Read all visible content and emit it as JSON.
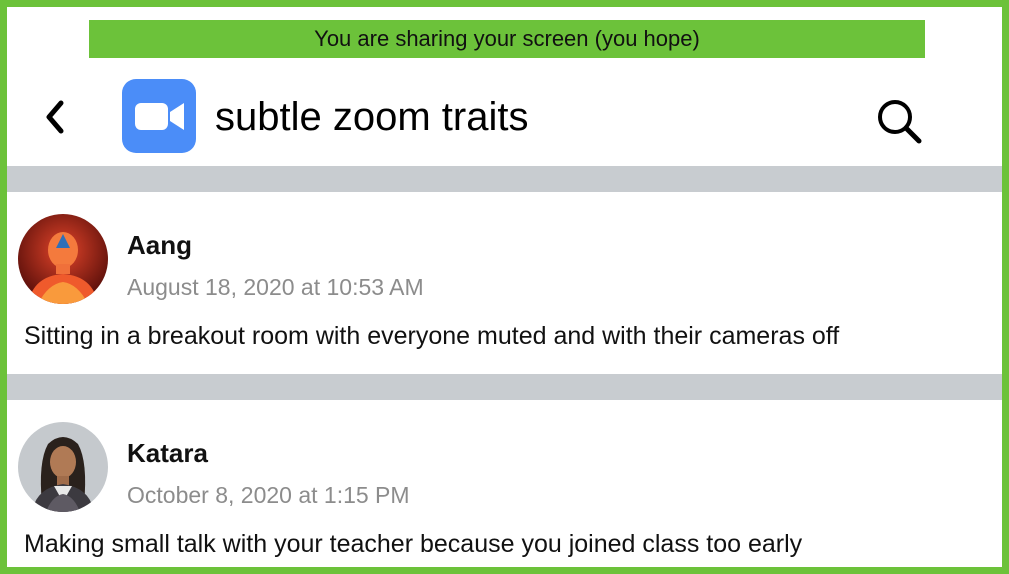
{
  "banner": {
    "text": "You are sharing your screen (you hope)"
  },
  "header": {
    "title": "subtle zoom traits",
    "back_icon": "chevron-left-icon",
    "logo_icon": "video-camera-icon",
    "search_icon": "search-icon"
  },
  "posts": [
    {
      "author": "Aang",
      "timestamp": "August 18, 2020 at 10:53 AM",
      "text": "Sitting in a breakout room with everyone muted and with their cameras off"
    },
    {
      "author": "Katara",
      "timestamp": "October 8, 2020 at 1:15 PM",
      "text": "Making small talk with your teacher because you joined class too early"
    }
  ],
  "colors": {
    "frame": "#6cc23a",
    "banner": "#6cc23a",
    "logo": "#4b8df8",
    "divider": "#c8ccd0",
    "timestamp": "#8c8c8c"
  }
}
